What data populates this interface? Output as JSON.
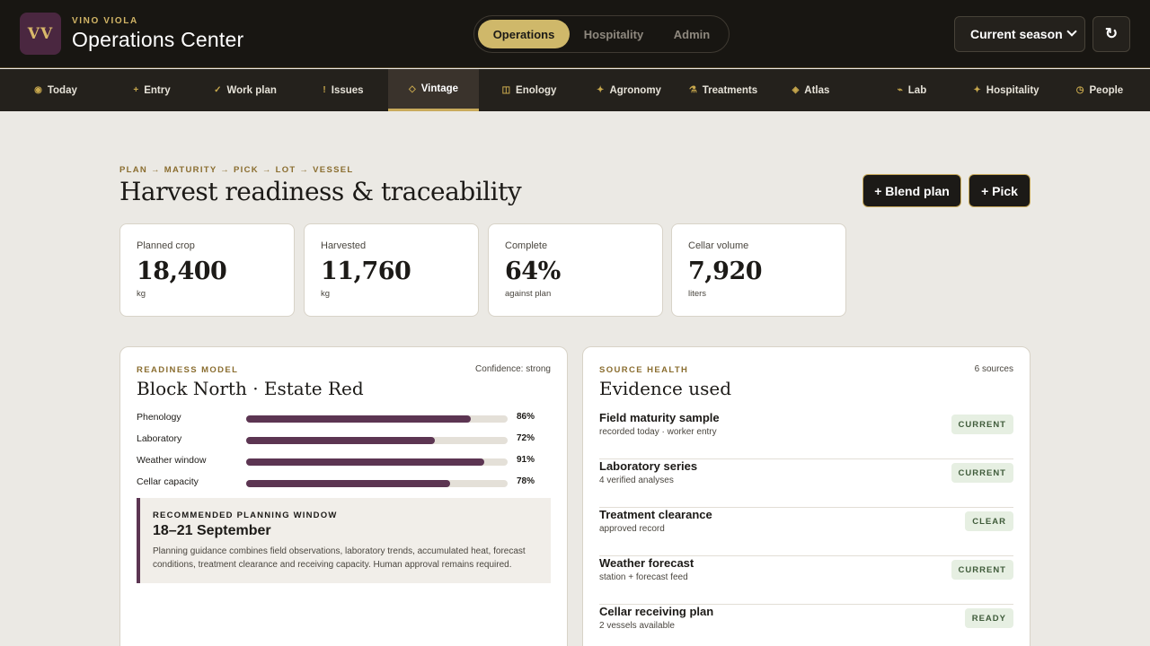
{
  "app": {
    "logo": "VV",
    "brand": "VINO VIOLA",
    "title": "Operations Center"
  },
  "modes": [
    {
      "label": "Operations",
      "active": true
    },
    {
      "label": "Hospitality",
      "active": false
    },
    {
      "label": "Admin",
      "active": false
    }
  ],
  "season_select": {
    "value": "Current season"
  },
  "refresh": {
    "icon": "↻"
  },
  "nav": [
    {
      "icon": "◉",
      "label": "Today"
    },
    {
      "icon": "+",
      "label": "Entry"
    },
    {
      "icon": "✓",
      "label": "Work plan"
    },
    {
      "icon": "!",
      "label": "Issues"
    },
    {
      "icon": "◇",
      "label": "Vintage"
    },
    {
      "icon": "◫",
      "label": "Enology"
    },
    {
      "icon": "✦",
      "label": "Agronomy"
    },
    {
      "icon": "⚗",
      "label": "Treatments"
    },
    {
      "icon": "◈",
      "label": "Atlas"
    },
    {
      "icon": "⌁",
      "label": "Lab"
    },
    {
      "icon": "✦",
      "label": "Hospitality"
    },
    {
      "icon": "◷",
      "label": "People"
    }
  ],
  "page": {
    "breadcrumb": "PLAN → MATURITY → PICK → LOT → VESSEL",
    "title": "Harvest readiness & traceability",
    "actions": {
      "blend": "+ Blend plan",
      "pick": "+ Pick"
    }
  },
  "stats": [
    {
      "label": "Planned crop",
      "value": "18,400",
      "unit": "kg"
    },
    {
      "label": "Harvested",
      "value": "11,760",
      "unit": "kg"
    },
    {
      "label": "Complete",
      "value": "64%",
      "unit": "against plan"
    },
    {
      "label": "Cellar volume",
      "value": "7,920",
      "unit": "liters"
    }
  ],
  "readiness": {
    "eyebrow": "READINESS MODEL",
    "confidence": "Confidence: strong",
    "title": "Block North · Estate Red",
    "bars": [
      {
        "label": "Phenology",
        "value": 86,
        "text": "86%"
      },
      {
        "label": "Laboratory",
        "value": 72,
        "text": "72%"
      },
      {
        "label": "Weather window",
        "value": 91,
        "text": "91%"
      },
      {
        "label": "Cellar capacity",
        "value": 78,
        "text": "78%"
      }
    ],
    "bar_color": "#5c3552",
    "recommendation": {
      "eyebrow": "RECOMMENDED PLANNING WINDOW",
      "title": "18–21 September",
      "text": "Planning guidance combines field observations, laboratory trends, accumulated heat, forecast conditions, treatment clearance and receiving capacity. Human approval remains required."
    }
  },
  "sources": {
    "eyebrow": "SOURCE HEALTH",
    "count": "6 sources",
    "title": "Evidence used",
    "items": [
      {
        "title": "Field maturity sample",
        "sub": "recorded today · worker entry",
        "status": "CURRENT"
      },
      {
        "title": "Laboratory series",
        "sub": "4 verified analyses",
        "status": "CURRENT"
      },
      {
        "title": "Treatment clearance",
        "sub": "approved record",
        "status": "CLEAR"
      },
      {
        "title": "Weather forecast",
        "sub": "station + forecast feed",
        "status": "CURRENT"
      },
      {
        "title": "Cellar receiving plan",
        "sub": "2 vessels available",
        "status": "READY"
      }
    ]
  },
  "colors": {
    "accent": "#cfb86a",
    "brand_dark": "#181612",
    "plum": "#5c3552"
  }
}
